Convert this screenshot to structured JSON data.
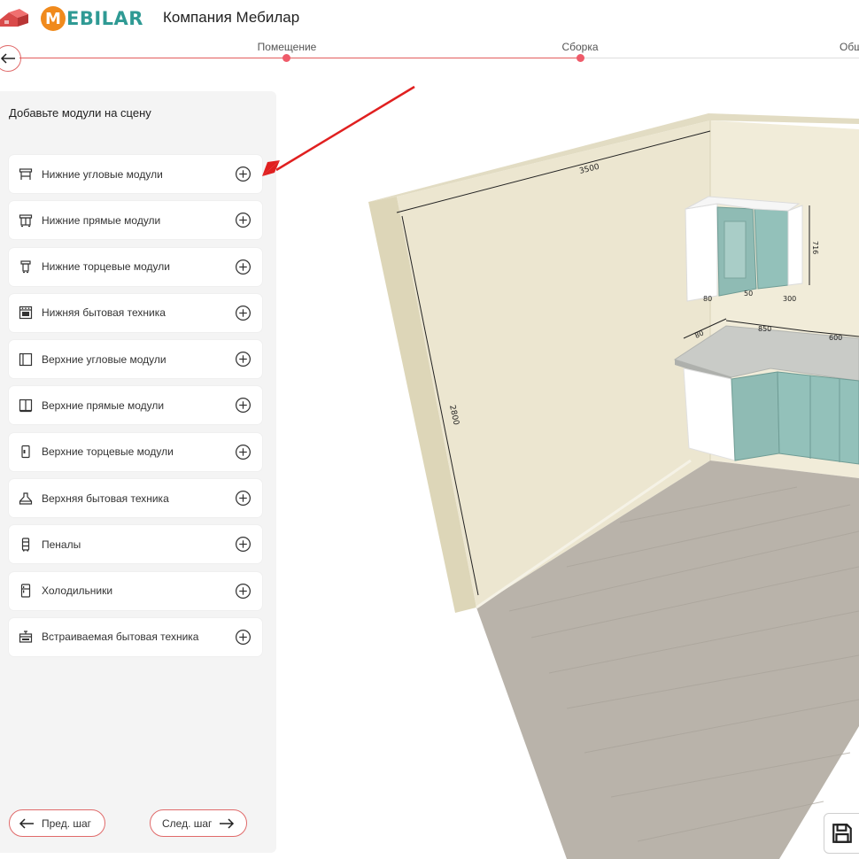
{
  "header": {
    "logo_letter": "M",
    "logo_text": "EBILAR",
    "company_name": "Компания Мебилар"
  },
  "stepper": {
    "steps": [
      {
        "label": "Помещение",
        "state": "done"
      },
      {
        "label": "Сборка",
        "state": "active"
      },
      {
        "label": "Общ",
        "state": "upcoming"
      }
    ]
  },
  "sidebar": {
    "title": "Добавьте модули на сцену",
    "items": [
      {
        "label": "Нижние угловые модули",
        "icon": "lower-corner-module-icon"
      },
      {
        "label": "Нижние прямые модули",
        "icon": "lower-straight-module-icon"
      },
      {
        "label": "Нижние торцевые модули",
        "icon": "lower-end-module-icon"
      },
      {
        "label": "Нижняя бытовая техника",
        "icon": "oven-icon"
      },
      {
        "label": "Верхние угловые модули",
        "icon": "upper-corner-module-icon"
      },
      {
        "label": "Верхние прямые модули",
        "icon": "upper-straight-module-icon"
      },
      {
        "label": "Верхние торцевые модули",
        "icon": "upper-end-module-icon"
      },
      {
        "label": "Верхняя бытовая техника",
        "icon": "range-hood-icon"
      },
      {
        "label": "Пеналы",
        "icon": "tall-cabinet-icon"
      },
      {
        "label": "Холодильники",
        "icon": "fridge-icon"
      },
      {
        "label": "Встраиваемая бытовая техника",
        "icon": "built-in-appliance-icon"
      }
    ],
    "prev_label": "Пред. шаг",
    "next_label": "След. шаг"
  },
  "scene": {
    "dimensions": {
      "wall_width": "3500",
      "wall_height": "2800",
      "upper_height": "716",
      "upper_depth": "300",
      "upper_small_a": "80",
      "upper_small_b": "50",
      "counter_left": "80",
      "counter_mid": "850",
      "counter_right": "600"
    }
  },
  "colors": {
    "accent": "#ef5b6a",
    "brand_teal": "#2f9a94",
    "brand_orange": "#f08a1c",
    "wall": "#ece6d0",
    "cabinet": "#8fbbb4"
  }
}
